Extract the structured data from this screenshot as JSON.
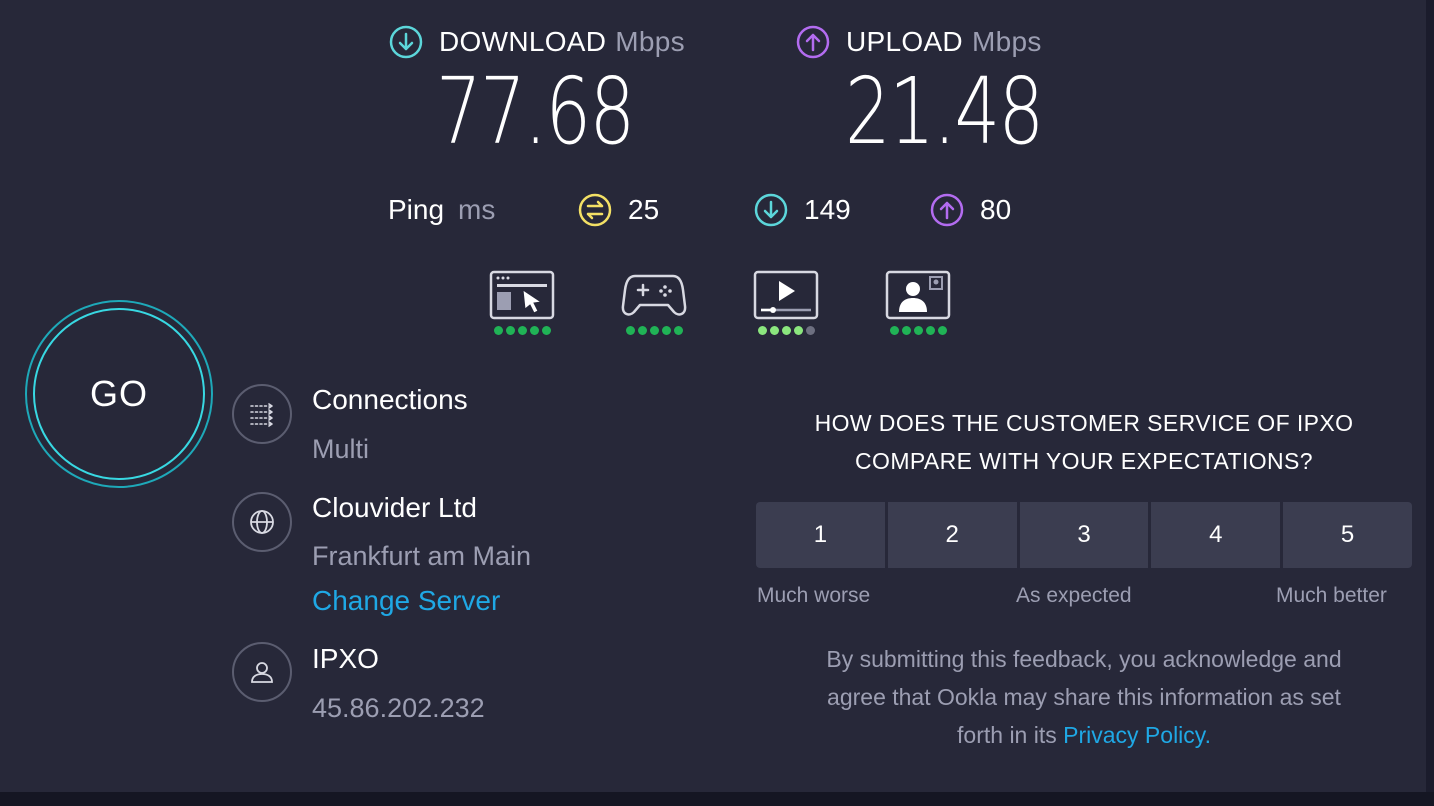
{
  "download": {
    "label": "DOWNLOAD",
    "unit": "Mbps",
    "value": "77.68"
  },
  "upload": {
    "label": "UPLOAD",
    "unit": "Mbps",
    "value": "21.48"
  },
  "ping": {
    "label": "Ping",
    "unit": "ms",
    "idle": "25",
    "download": "149",
    "upload": "80"
  },
  "quality": {
    "browsing": {
      "icon": "web-browsing-icon",
      "score": 5
    },
    "gaming": {
      "icon": "gamepad-icon",
      "score": 5
    },
    "streaming": {
      "icon": "video-streaming-icon",
      "score": 4
    },
    "video_calls": {
      "icon": "video-call-icon",
      "score": 5
    }
  },
  "go_button": {
    "label": "GO"
  },
  "connections": {
    "title": "Connections",
    "value": "Multi",
    "icon": "connections-icon"
  },
  "server": {
    "name": "Clouvider Ltd",
    "location": "Frankfurt am Main",
    "change_label": "Change Server",
    "icon": "globe-icon"
  },
  "provider": {
    "name": "IPXO",
    "ip": "45.86.202.232",
    "icon": "user-icon"
  },
  "survey": {
    "question_line1": "HOW DOES THE CUSTOMER SERVICE OF IPXO",
    "question_line2": "COMPARE WITH YOUR EXPECTATIONS?",
    "options": [
      "1",
      "2",
      "3",
      "4",
      "5"
    ],
    "low_label": "Much worse",
    "mid_label": "As expected",
    "high_label": "Much better",
    "disclaimer_line1": "By submitting this feedback, you acknowledge and",
    "disclaimer_line2": "agree that Ookla may share this information as set",
    "disclaimer_line3_prefix": "forth in its ",
    "privacy_link": "Privacy Policy",
    "disclaimer_suffix": "."
  },
  "colors": {
    "download": "#5cd6da",
    "upload": "#b36cf0",
    "ping": "#f3e065",
    "link": "#1fa8e5",
    "go_ring": "#38d8e2"
  }
}
